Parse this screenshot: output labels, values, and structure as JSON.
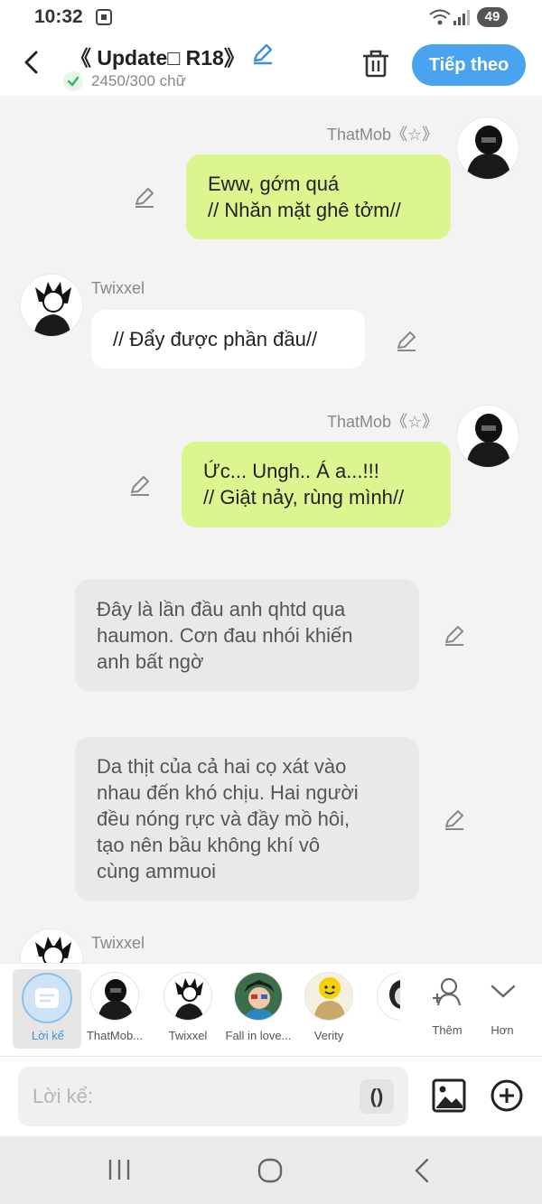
{
  "status": {
    "time": "10:32",
    "battery": "49"
  },
  "header": {
    "title": "《 Update□ R18》",
    "word_count": "2450/300 chữ",
    "next_label": "Tiếp theo"
  },
  "messages": [
    {
      "side": "right",
      "name": "ThatMob《☆》",
      "lines": [
        "Eww, gớm quá",
        "// Nhăn mặt ghê tởm//"
      ]
    },
    {
      "side": "left",
      "name": "Twixxel",
      "lines": [
        "// Đẩy được phần đầu//"
      ]
    },
    {
      "side": "right",
      "name": "ThatMob《☆》",
      "lines": [
        "Ức... Ungh.. Á a...!!!",
        "// Giật nảy, rùng mình//"
      ]
    },
    {
      "side": "narration",
      "lines": [
        "Đây là lần đầu anh qhtd qua",
        "haumon. Cơn đau nhói khiến",
        "anh bất ngờ"
      ]
    },
    {
      "side": "narration",
      "lines": [
        "Da thịt của cả hai cọ xát vào",
        "nhau đến khó chịu. Hai người",
        "đều nóng rực và đầy mồ hôi,",
        "tạo nên bầu không khí vô",
        "cùng ammuoi"
      ]
    },
    {
      "side": "left",
      "name": "Twixxel",
      "lines": []
    }
  ],
  "characters": [
    {
      "label": "Lời kể",
      "icon": "narration-icon"
    },
    {
      "label": "ThatMob...",
      "icon": "avatar-thatmob"
    },
    {
      "label": "Twixxel",
      "icon": "avatar-twixxel"
    },
    {
      "label": "Fall in love...",
      "icon": "avatar-fall-in-love"
    },
    {
      "label": "Verity",
      "icon": "avatar-verity"
    }
  ],
  "strip_actions": {
    "add_label": "Thêm",
    "more_label": "Hơn"
  },
  "input": {
    "placeholder": "Lời kể:",
    "paren_label": "()"
  },
  "colors": {
    "accent": "#4aa3f0",
    "bubble_green": "#ddf58f",
    "narration_bg": "#e9e9e9"
  }
}
